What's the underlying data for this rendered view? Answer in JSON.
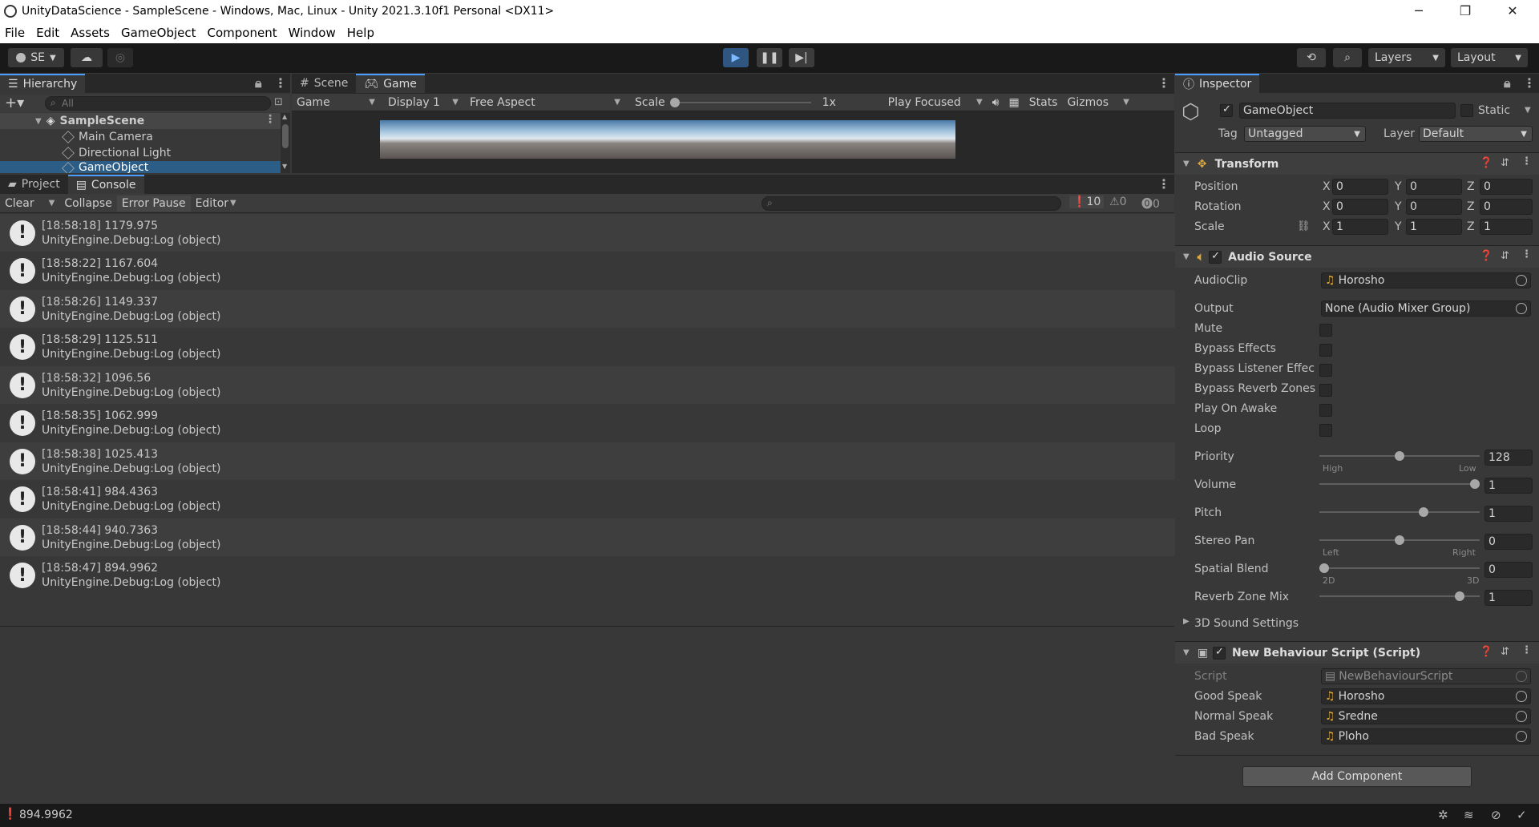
{
  "window": {
    "title": "UnityDataScience - SampleScene - Windows, Mac, Linux - Unity 2021.3.10f1 Personal <DX11>",
    "minimize": "─",
    "maximize": "❐",
    "close": "✕"
  },
  "menu": [
    "File",
    "Edit",
    "Assets",
    "GameObject",
    "Component",
    "Window",
    "Help"
  ],
  "toolbar": {
    "account": "SE",
    "layers": "Layers",
    "layout": "Layout"
  },
  "hierarchy": {
    "tab": "Hierarchy",
    "search_placeholder": "All",
    "scene": "SampleScene",
    "items": [
      "Main Camera",
      "Directional Light",
      "GameObject"
    ]
  },
  "game_view": {
    "tabs": [
      "Scene",
      "Game"
    ],
    "mode": "Game",
    "display": "Display 1",
    "aspect": "Free Aspect",
    "scale_label": "Scale",
    "scale_value": "1x",
    "play_focused": "Play Focused",
    "stats": "Stats",
    "gizmos": "Gizmos"
  },
  "console": {
    "tabs": [
      "Project",
      "Console"
    ],
    "buttons": {
      "clear": "Clear",
      "collapse": "Collapse",
      "error_pause": "Error Pause",
      "editor": "Editor"
    },
    "counts": {
      "logs": "10",
      "warnings": "0",
      "errors": "0"
    },
    "entries": [
      {
        "line1": "[18:58:18] 1179.975",
        "line2": "UnityEngine.Debug:Log (object)"
      },
      {
        "line1": "[18:58:22] 1167.604",
        "line2": "UnityEngine.Debug:Log (object)"
      },
      {
        "line1": "[18:58:26] 1149.337",
        "line2": "UnityEngine.Debug:Log (object)"
      },
      {
        "line1": "[18:58:29] 1125.511",
        "line2": "UnityEngine.Debug:Log (object)"
      },
      {
        "line1": "[18:58:32] 1096.56",
        "line2": "UnityEngine.Debug:Log (object)"
      },
      {
        "line1": "[18:58:35] 1062.999",
        "line2": "UnityEngine.Debug:Log (object)"
      },
      {
        "line1": "[18:58:38] 1025.413",
        "line2": "UnityEngine.Debug:Log (object)"
      },
      {
        "line1": "[18:58:41] 984.4363",
        "line2": "UnityEngine.Debug:Log (object)"
      },
      {
        "line1": "[18:58:44] 940.7363",
        "line2": "UnityEngine.Debug:Log (object)"
      },
      {
        "line1": "[18:58:47] 894.9962",
        "line2": "UnityEngine.Debug:Log (object)"
      }
    ]
  },
  "inspector": {
    "tab": "Inspector",
    "object_name": "GameObject",
    "static_label": "Static",
    "tag_label": "Tag",
    "tag_value": "Untagged",
    "layer_label": "Layer",
    "layer_value": "Default",
    "transform": {
      "title": "Transform",
      "position": {
        "label": "Position",
        "x": "0",
        "y": "0",
        "z": "0"
      },
      "rotation": {
        "label": "Rotation",
        "x": "0",
        "y": "0",
        "z": "0"
      },
      "scale": {
        "label": "Scale",
        "x": "1",
        "y": "1",
        "z": "1"
      },
      "axis_x": "X",
      "axis_y": "Y",
      "axis_z": "Z"
    },
    "audio_source": {
      "title": "Audio Source",
      "audioclip_label": "AudioClip",
      "audioclip_value": "Horosho",
      "output_label": "Output",
      "output_value": "None (Audio Mixer Group)",
      "mute": "Mute",
      "bypass_effects": "Bypass Effects",
      "bypass_listener": "Bypass Listener Effec",
      "bypass_reverb": "Bypass Reverb Zones",
      "play_on_awake": "Play On Awake",
      "loop": "Loop",
      "priority_label": "Priority",
      "priority_value": "128",
      "priority_fraction": 0.5,
      "volume_label": "Volume",
      "volume_value": "1",
      "volume_fraction": 1.0,
      "pitch_label": "Pitch",
      "pitch_value": "1",
      "pitch_fraction": 0.66,
      "stereo_label": "Stereo Pan",
      "stereo_value": "0",
      "stereo_fraction": 0.5,
      "spatial_label": "Spatial Blend",
      "spatial_value": "0",
      "spatial_fraction": 0.0,
      "reverb_label": "Reverb Zone Mix",
      "reverb_value": "1",
      "reverb_fraction": 0.9,
      "high": "High",
      "low": "Low",
      "left": "Left",
      "right": "Right",
      "twod": "2D",
      "threed": "3D",
      "sound3d": "3D Sound Settings"
    },
    "script": {
      "title": "New Behaviour Script (Script)",
      "script_label": "Script",
      "script_value": "NewBehaviourScript",
      "good_label": "Good Speak",
      "good_value": "Horosho",
      "normal_label": "Normal Speak",
      "normal_value": "Sredne",
      "bad_label": "Bad Speak",
      "bad_value": "Ploho"
    },
    "add_component": "Add Component"
  },
  "status": {
    "message": "894.9962"
  }
}
